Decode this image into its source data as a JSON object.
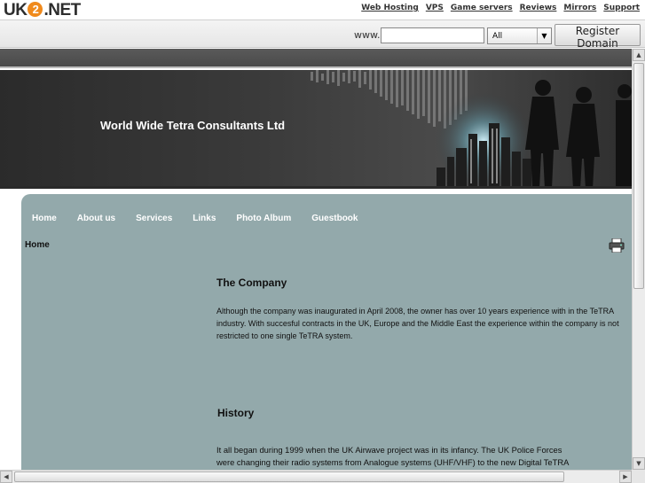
{
  "host": {
    "logo_text_a": "UK",
    "logo_text_2": "2",
    "logo_text_b": ".NET",
    "links": [
      "Web Hosting",
      "VPS",
      "Game servers",
      "Reviews",
      "Mirrors",
      "Support"
    ]
  },
  "domain_search": {
    "prefix": "www.",
    "input_value": "",
    "tld_selected": "All",
    "register_label": "Register Domain"
  },
  "site": {
    "title": "World Wide Tetra Consultants Ltd",
    "nav": [
      "Home",
      "About us",
      "Services",
      "Links",
      "Photo Album",
      "Guestbook"
    ],
    "breadcrumb": "Home",
    "company_heading": "The Company",
    "company_text": "Although the company was inaugurated in April 2008, the owner has over 10 years experience with in the TeTRA industry. With succesful contracts in the UK, Europe and the Middle East the experience within the company is not restricted to one single TeTRA system.",
    "history_heading": "History",
    "history_line1": "It all began during 1999 when the UK Airwave project was in its infancy. The UK Police Forces",
    "history_line2": "were changing their radio systems from Analogue systems (UHF/VHF) to the new Digital TeTRA"
  },
  "colors": {
    "panel": "#93a9ab",
    "banner_dark": "#2b2b2b",
    "logo_accent": "#f08a1c"
  },
  "icons": {
    "printer": "printer-icon",
    "dropdown": "chevron-down-icon"
  }
}
